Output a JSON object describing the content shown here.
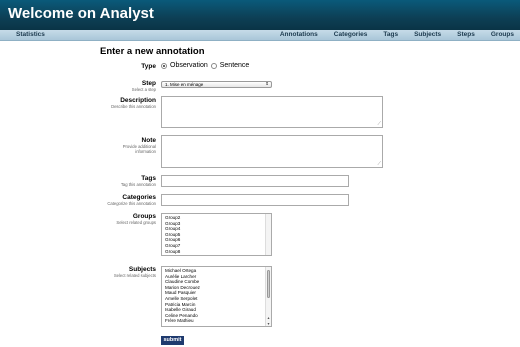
{
  "header": {
    "title": "Welcome on Analyst"
  },
  "nav": {
    "left_item": "Statistics",
    "items": [
      "Annotations",
      "Categories",
      "Tags",
      "Subjects",
      "Steps",
      "Groups"
    ]
  },
  "form": {
    "title": "Enter a new annotation",
    "type": {
      "label": "Type",
      "options": [
        "Observation",
        "Sentence"
      ],
      "selected": "Observation"
    },
    "step": {
      "label": "Step",
      "hint": "Select a step",
      "value": "1. Mise en ménage"
    },
    "description": {
      "label": "Description",
      "hint": "Describe this annotation",
      "value": ""
    },
    "note": {
      "label": "Note",
      "hint_line1": "Provide additional",
      "hint_line2": "information",
      "value": ""
    },
    "tags": {
      "label": "Tags",
      "hint": "Tag this annotation",
      "value": ""
    },
    "categories": {
      "label": "Categories",
      "hint": "Categorize this annotation",
      "value": ""
    },
    "groups": {
      "label": "Groups",
      "hint": "Select related groups",
      "options": [
        "Group2",
        "Group3",
        "Group4",
        "Group5",
        "Group6",
        "Group7",
        "Group8"
      ]
    },
    "subjects": {
      "label": "Subjects",
      "hint": "Select related subjects",
      "options": [
        "Michael Ortega",
        "Aurélie Larcher",
        "Claudine Combe",
        "Marion Decrouez",
        "Maud Pasquier",
        "Amelle Serpolet",
        "Patricia Marcin",
        "Isabelle Giraud",
        "Celine Penando",
        "Frère Mathieu"
      ]
    },
    "submit_label": "submit"
  }
}
